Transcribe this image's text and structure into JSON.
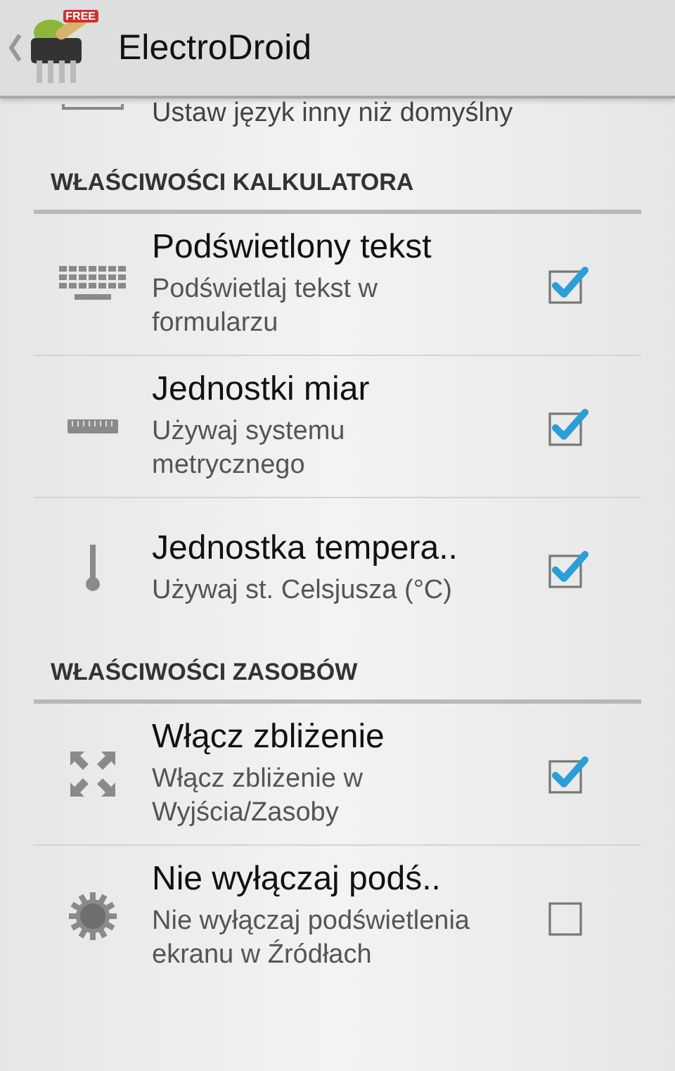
{
  "action_bar": {
    "title": "ElectroDroid",
    "badge": "FREE"
  },
  "partial_item": {
    "summary": "Ustaw język inny niż domyślny"
  },
  "sections": [
    {
      "title": "WŁAŚCIWOŚCI KALKULATORA",
      "items": [
        {
          "title": "Podświetlony tekst",
          "summary": "Podświetlaj tekst w formularzu",
          "checked": true
        },
        {
          "title": "Jednostki miar",
          "summary": "Używaj systemu metrycznego",
          "checked": true
        },
        {
          "title": "Jednostka tempera..",
          "summary": "Używaj st. Celsjusza (°C)",
          "checked": true
        }
      ]
    },
    {
      "title": "WŁAŚCIWOŚCI ZASOBÓW",
      "items": [
        {
          "title": "Włącz zbliżenie",
          "summary": "Włącz zbliżenie w Wyjścia/Zasoby",
          "checked": true
        },
        {
          "title": "Nie wyłączaj podś..",
          "summary": "Nie wyłączaj podświetlenia ekranu w Źródłach",
          "checked": false
        }
      ]
    }
  ]
}
